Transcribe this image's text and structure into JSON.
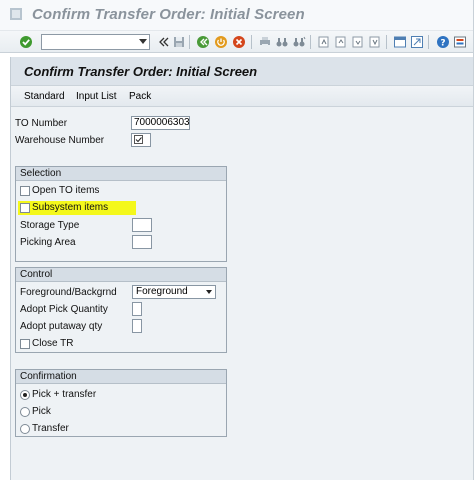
{
  "window": {
    "title": "Confirm Transfer Order: Initial Screen"
  },
  "toolbar": {
    "command_field_value": "",
    "icons": [
      "enter-icon",
      "back-icon",
      "save-icon",
      "exit-icon",
      "cancel-icon",
      "print-icon",
      "find-icon",
      "find-next-icon",
      "first-page-icon",
      "previous-page-icon",
      "next-page-icon",
      "last-page-icon",
      "create-session-icon",
      "shortcut-icon",
      "help-icon",
      "customize-layout-icon"
    ]
  },
  "screen": {
    "title": "Confirm Transfer Order: Initial Screen",
    "app_buttons": [
      "Standard",
      "Input List",
      "Pack"
    ]
  },
  "header_fields": {
    "to_number_label": "TO Number",
    "to_number_value": "7000006303",
    "warehouse_label": "Warehouse Number",
    "warehouse_value": ""
  },
  "selection": {
    "title": "Selection",
    "open_to_items_label": "Open TO items",
    "open_to_items_checked": false,
    "subsystem_items_label": "Subsystem items",
    "subsystem_items_checked": false,
    "subsystem_highlight_color": "#f4f81b",
    "storage_type_label": "Storage Type",
    "storage_type_value": "",
    "picking_area_label": "Picking Area",
    "picking_area_value": ""
  },
  "control": {
    "title": "Control",
    "foreground_label": "Foreground/Backgrnd",
    "foreground_value": "Foreground",
    "adopt_pick_label": "Adopt Pick Quantity",
    "adopt_pick_value": "",
    "adopt_putaway_label": "Adopt putaway qty",
    "adopt_putaway_value": "",
    "close_tr_label": "Close TR",
    "close_tr_checked": false
  },
  "confirmation": {
    "title": "Confirmation",
    "options": [
      "Pick + transfer",
      "Pick",
      "Transfer"
    ],
    "selected": "Pick + transfer"
  }
}
